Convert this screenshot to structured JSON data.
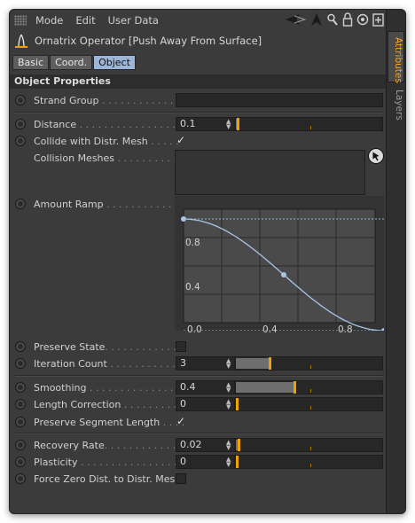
{
  "menubar": {
    "items": [
      "Mode",
      "Edit",
      "User Data"
    ]
  },
  "titlebar": {
    "title": "Ornatrix Operator [Push Away From Surface]"
  },
  "tabs": [
    {
      "label": "Basic",
      "active": false
    },
    {
      "label": "Coord.",
      "active": false
    },
    {
      "label": "Object",
      "active": true
    }
  ],
  "section": {
    "title": "Object Properties"
  },
  "params": {
    "strand_group": {
      "label": "Strand Group",
      "dots": " . . . . . . . . . . . . . .",
      "value": ""
    },
    "distance": {
      "label": "Distance",
      "dots": " . . . . . . . . . . . . . . . . .",
      "value": "0.1",
      "fraction": 0.01
    },
    "collide": {
      "label": "Collide with Distr. Mesh",
      "dots": " . . . . .",
      "checked": true,
      "check_glyph": "✓"
    },
    "collision_meshes": {
      "label": "Collision Meshes",
      "dots": " . . . . . . . . . ."
    },
    "amount_ramp": {
      "label": "Amount Ramp",
      "dots": " . . . . . . . . . . . ."
    },
    "preserve_state": {
      "label": "Preserve State",
      "dots": ". . . . . . . . . . . . .",
      "checked": false
    },
    "iteration_count": {
      "label": "Iteration Count",
      "dots": " . . . . . . . . . . . .",
      "value": "3",
      "fraction": 0.23
    },
    "smoothing": {
      "label": "Smoothing",
      "dots": " . . . . . . . . . . . . . . . .",
      "value": "0.4",
      "fraction": 0.4
    },
    "length_correction": {
      "label": "Length Correction",
      "dots": " . . . . . . . . . .",
      "value": "0",
      "fraction": 0.0
    },
    "preserve_segment_length": {
      "label": "Preserve Segment Length",
      "dots": " . . . .",
      "checked": true,
      "check_glyph": "✓"
    },
    "recovery_rate": {
      "label": "Recovery Rate",
      "dots": ". . . . . . . . . . . . . . .",
      "value": "0.02",
      "fraction": 0.02
    },
    "plasticity": {
      "label": "Plasticity",
      "dots": " . . . . . . . . . . . . . . . . . .",
      "value": "0",
      "fraction": 0.0
    },
    "force_zero": {
      "label": "Force Zero Dist. to Distr. Mesh",
      "checked": false
    }
  },
  "ramp": {
    "x_ticks": [
      "0.0",
      "0.4",
      "0.8"
    ],
    "y_ticks": [
      "0.8",
      "0.4"
    ],
    "points": [
      [
        0,
        1
      ],
      [
        0.5,
        0.5
      ],
      [
        1,
        0
      ]
    ],
    "colors": {
      "curve": "#a9c4e6",
      "knot": "#a9c4e6"
    }
  },
  "side_tabs": [
    {
      "label": "Attributes",
      "active": true
    },
    {
      "label": "Layers",
      "active": false
    }
  ],
  "colors": {
    "accent": "#f0a200",
    "active_tab": "#9db5d6"
  }
}
